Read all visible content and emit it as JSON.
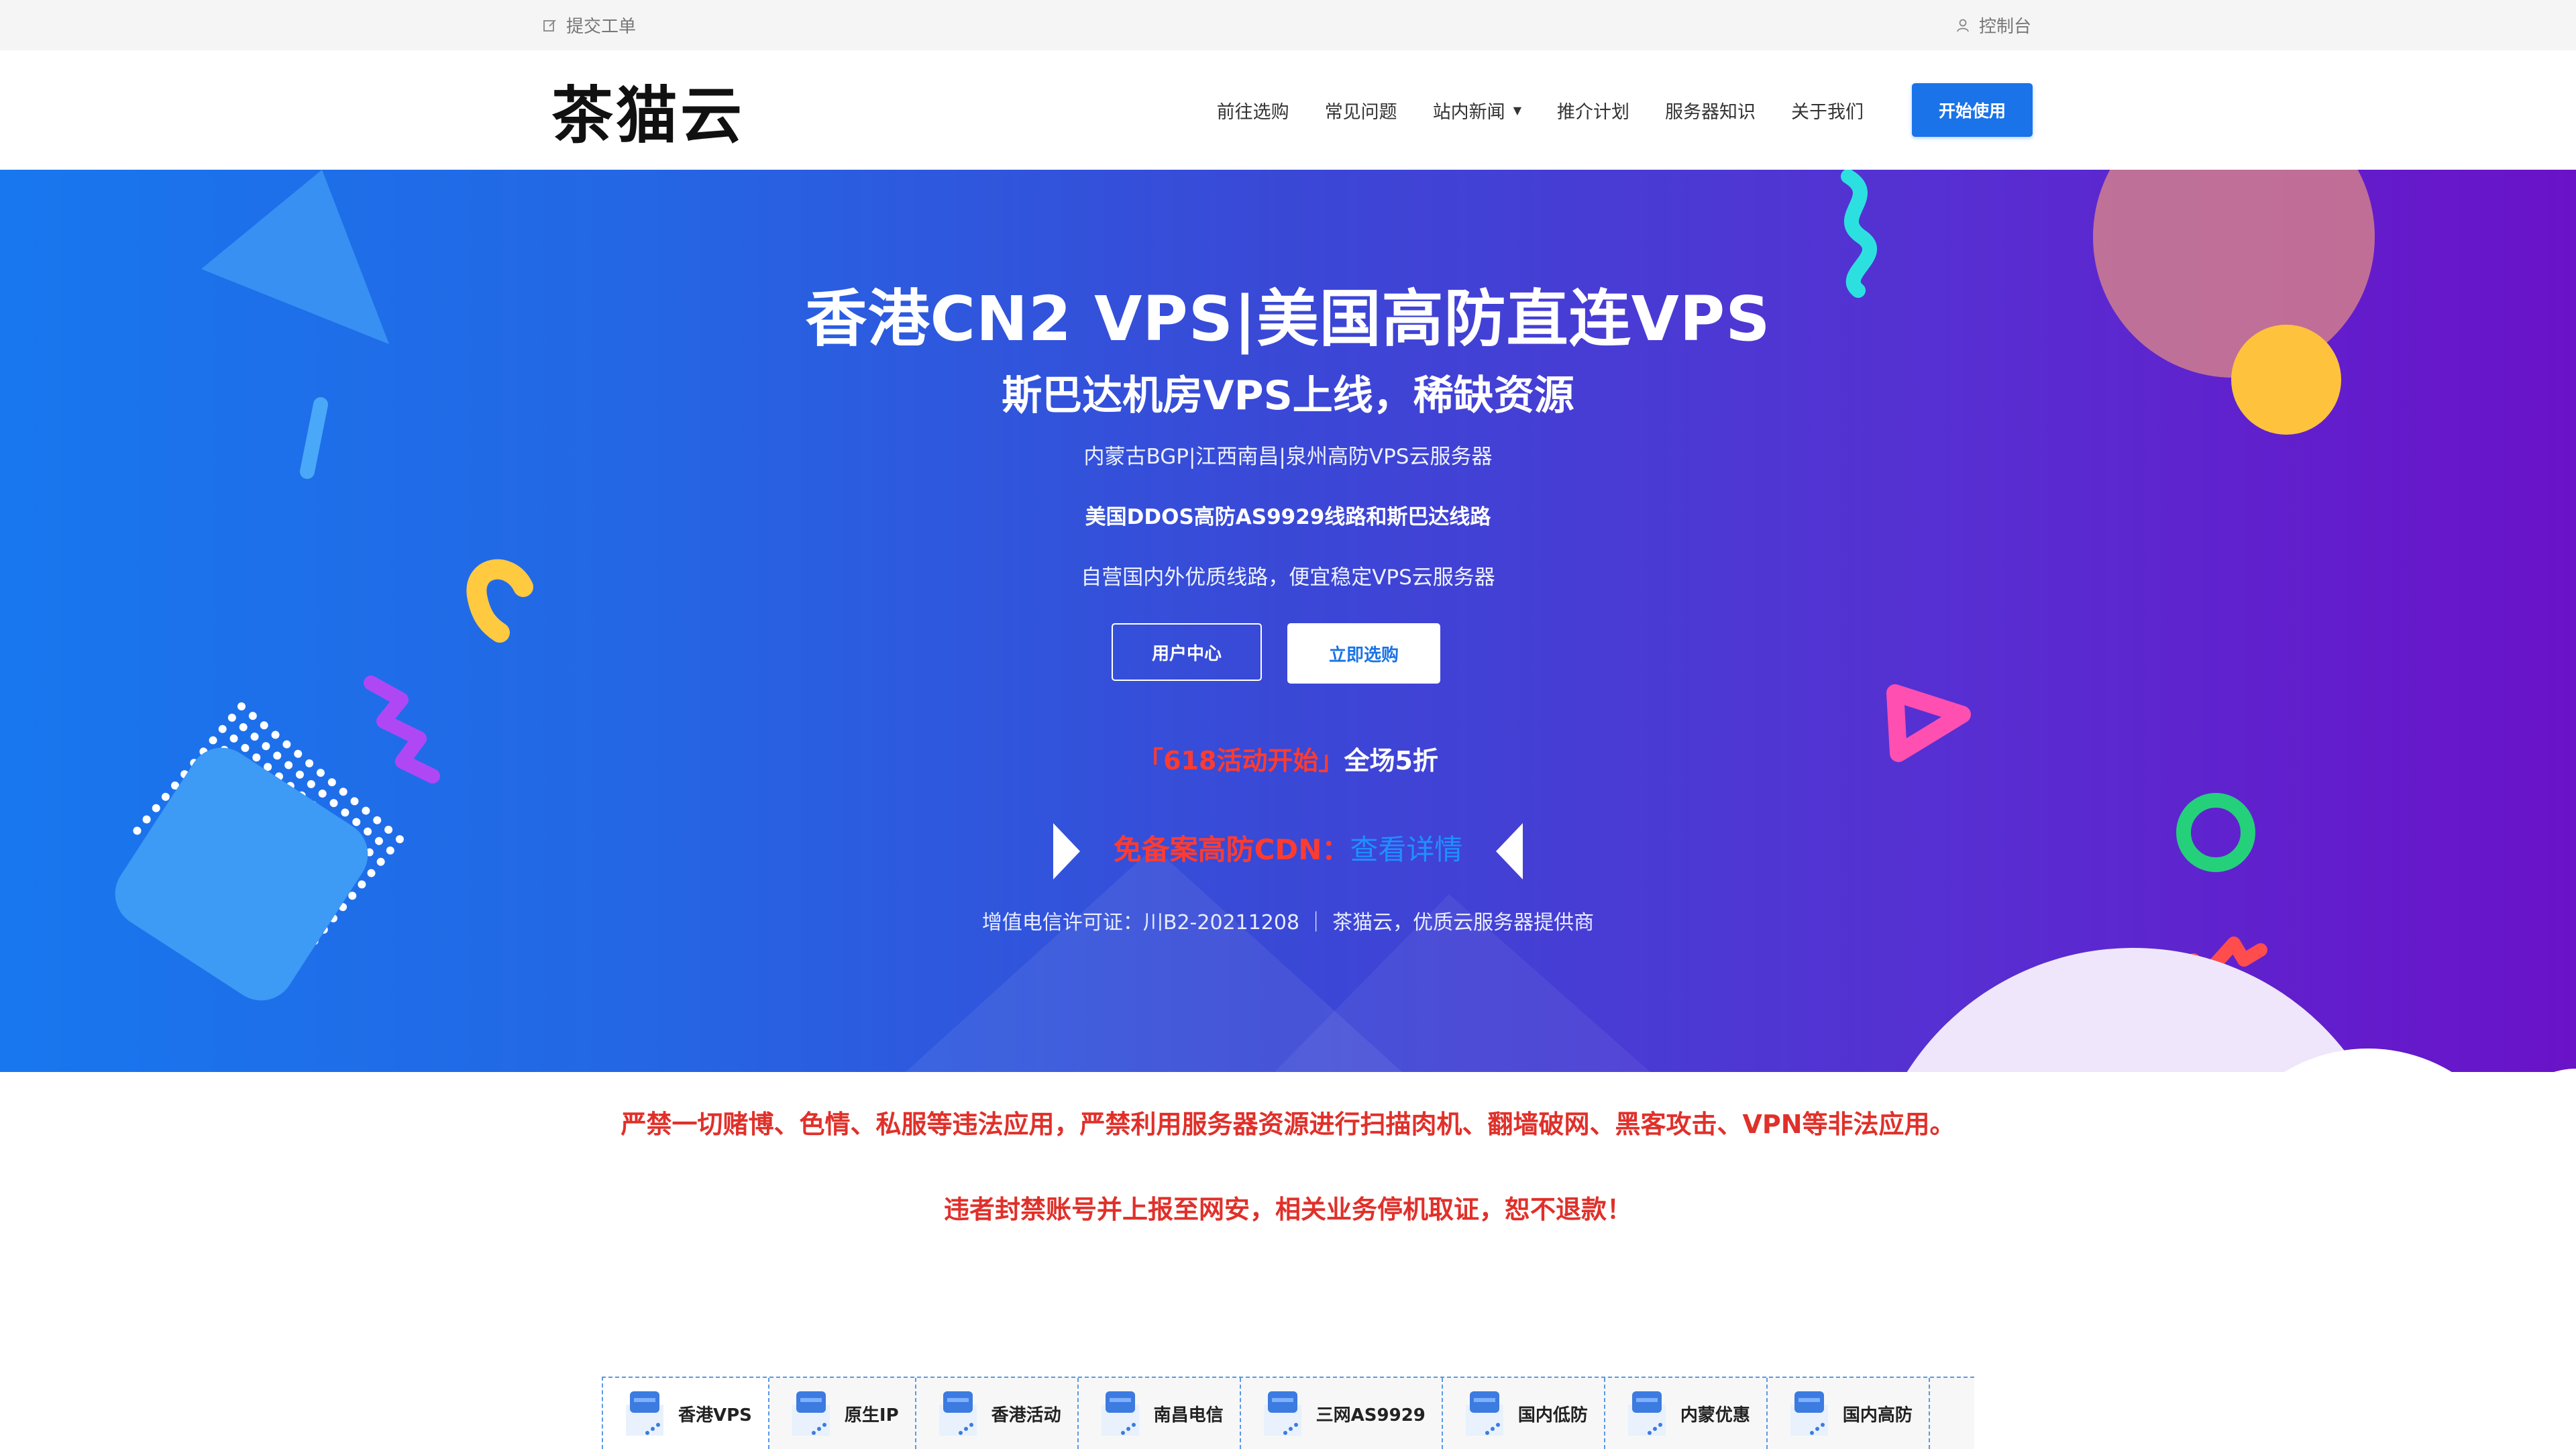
{
  "topbar": {
    "ticket": "提交工单",
    "console": "控制台"
  },
  "header": {
    "logo": "茶猫云",
    "nav": [
      {
        "label": "前往选购"
      },
      {
        "label": "常见问题"
      },
      {
        "label": "站内新闻",
        "has_dropdown": true
      },
      {
        "label": "推介计划"
      },
      {
        "label": "服务器知识"
      },
      {
        "label": "关于我们"
      }
    ],
    "start_button": "开始使用",
    "accent_color": "#1a73e8"
  },
  "hero": {
    "title": "香港CN2 VPS|美国高防直连VPS",
    "subtitle": "斯巴达机房VPS上线，稀缺资源",
    "lines": [
      "内蒙古BGP|江西南昌|泉州高防VPS云服务器",
      "美国DDOS高防AS9929线路和斯巴达线路",
      "自营国内外优质线路，便宜稳定VPS云服务器"
    ],
    "user_center_button": "用户中心",
    "buy_now_button": "立即选购",
    "promo_red": "「618活动开始」",
    "promo_white": "全场5折",
    "cdn_text": "免备案高防CDN：",
    "cdn_link": "查看详情",
    "license": "增值电信许可证：川B2-20211208  ｜  茶猫云，优质云服务器提供商",
    "gradient_start": "#1877ee",
    "gradient_end": "#6a12c8"
  },
  "notices": [
    "严禁一切赌博、色情、私服等违法应用，严禁利用服务器资源进行扫描肉机、翻墙破网、黑客攻击、VPN等非法应用。",
    "违者封禁账号并上报至网安，相关业务停机取证，恕不退款！"
  ],
  "tabs": [
    {
      "label": "香港VPS",
      "icon": "server-icon"
    },
    {
      "label": "原生IP",
      "icon": "server-icon"
    },
    {
      "label": "香港活动",
      "icon": "server-icon"
    },
    {
      "label": "南昌电信",
      "icon": "server-icon"
    },
    {
      "label": "三网AS9929",
      "icon": "server-icon"
    },
    {
      "label": "国内低防",
      "icon": "server-icon"
    },
    {
      "label": "内蒙优惠",
      "icon": "server-icon"
    },
    {
      "label": "国内高防",
      "icon": "server-icon"
    }
  ]
}
